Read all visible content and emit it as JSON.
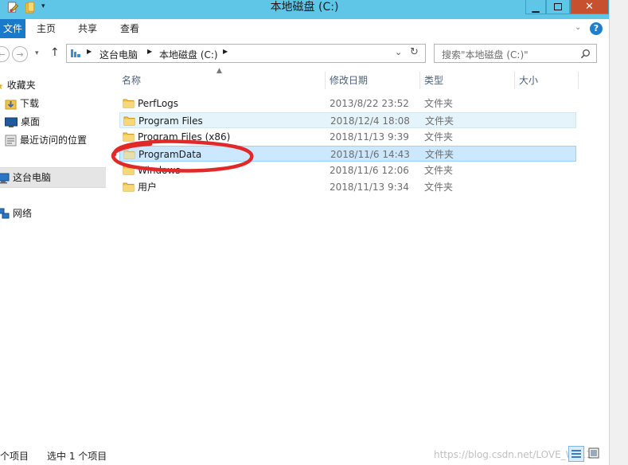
{
  "window": {
    "title": "本地磁盘 (C:)",
    "accent": "#5fc6e8",
    "close_color": "#c7502f"
  },
  "ribbon": {
    "tabs": [
      "文件",
      "主页",
      "共享",
      "查看"
    ]
  },
  "address": {
    "crumbs": [
      "这台电脑",
      "本地磁盘 (C:)"
    ]
  },
  "search": {
    "placeholder": "搜索\"本地磁盘 (C:)\""
  },
  "nav": {
    "favorites_label": "收藏夹",
    "favorites": [
      "下载",
      "桌面",
      "最近访问的位置"
    ],
    "this_pc": "这台电脑",
    "network": "网络"
  },
  "columns": {
    "name": "名称",
    "date": "修改日期",
    "type": "类型",
    "size": "大小"
  },
  "files": [
    {
      "name": "PerfLogs",
      "date": "2013/8/22 23:52",
      "type": "文件夹"
    },
    {
      "name": "Program Files",
      "date": "2018/12/4 18:08",
      "type": "文件夹"
    },
    {
      "name": "Program Files (x86)",
      "date": "2018/11/13 9:39",
      "type": "文件夹"
    },
    {
      "name": "ProgramData",
      "date": "2018/11/6 14:43",
      "type": "文件夹"
    },
    {
      "name": "Windows",
      "date": "2018/11/6 12:06",
      "type": "文件夹"
    },
    {
      "name": "用户",
      "date": "2018/11/13 9:34",
      "type": "文件夹"
    }
  ],
  "status": {
    "count": "个项目",
    "selected": "选中 1 个项目"
  },
  "watermark": "https://blog.csdn.net/LOVE_W_11"
}
